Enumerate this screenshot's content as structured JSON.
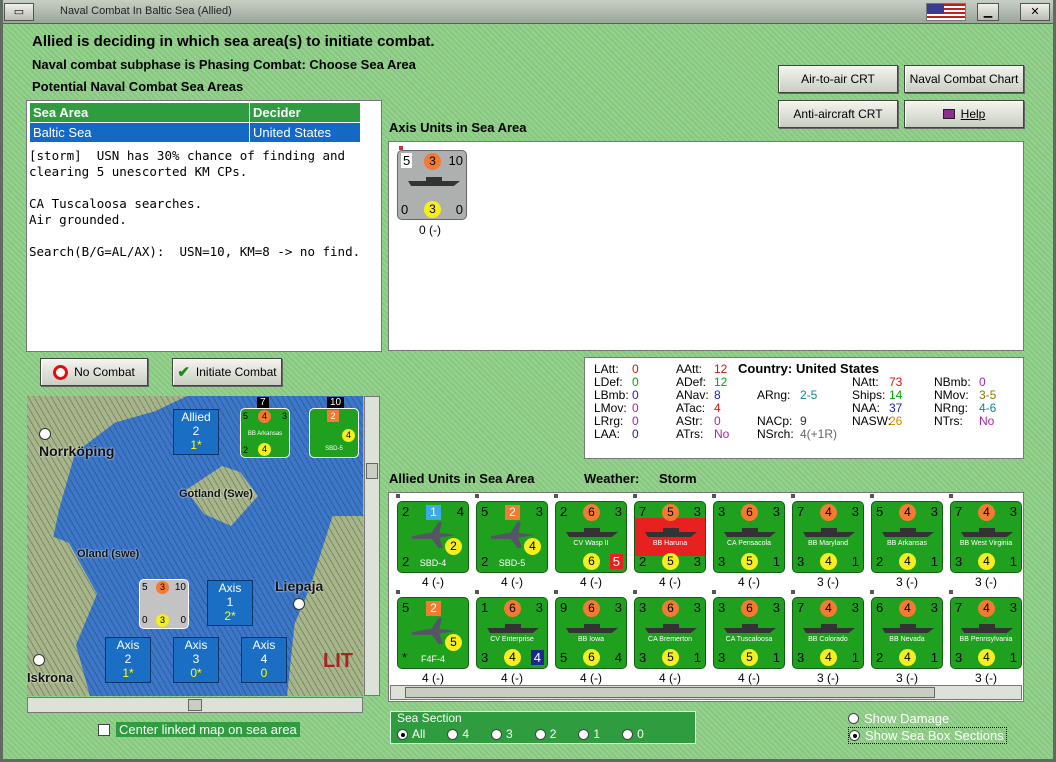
{
  "window": {
    "title": "Naval Combat In Baltic Sea (Allied)"
  },
  "status": {
    "line1": "Allied is deciding in which sea area(s) to initiate combat.",
    "line2": "Naval combat subphase is Phasing Combat: Choose Sea Area",
    "line3": "Potential Naval Combat Sea Areas"
  },
  "buttons": {
    "air_crt": "Air-to-air CRT",
    "naval_chart": "Naval Combat Chart",
    "aa_crt": "Anti-aircraft CRT",
    "help": "Help",
    "no_combat": "No Combat",
    "initiate": "Initiate Combat"
  },
  "areas_table": {
    "headers": [
      "Sea Area",
      "Decider"
    ],
    "rows": [
      [
        "Baltic Sea",
        "United States"
      ]
    ]
  },
  "log": "[storm]  USN has 30% chance of finding and\nclearing 5 unescorted KM CPs.\n\nCA Tuscaloosa searches.\nAir grounded.\n\nSearch(B/G=AL/AX):  USN=10, KM=8 -> no find.",
  "axis": {
    "label": "Axis Units in Sea Area",
    "unit": {
      "tl": "5",
      "tc": "3",
      "tr": "10",
      "bl": "0",
      "bc": "3",
      "br": "0",
      "count": "0 (-)"
    }
  },
  "stats": {
    "latt": "0",
    "ldef": "0",
    "lbmb": "0",
    "lmov": "0",
    "lrg": "0",
    "laa": "0",
    "aatt": "12",
    "adef": "12",
    "anav": "8",
    "atac": "4",
    "astr": "0",
    "atrs": "No",
    "country_label": "Country:",
    "country": "United States",
    "arng": "2-5",
    "nacp": "9",
    "nsrch": "4(+1R)",
    "natt": "73",
    "ships": "14",
    "naa": "37",
    "nasw": "26",
    "nbmb": "0",
    "nmov": "3-5",
    "nrng": "4-6",
    "ntrs": "No",
    "labels": {
      "latt": "LAtt:",
      "ldef": "LDef:",
      "lbmb": "LBmb:",
      "lmov": "LMov:",
      "lrg": "LRrg:",
      "laa": "LAA:",
      "aatt": "AAtt:",
      "adef": "ADef:",
      "anav": "ANav:",
      "atac": "ATac:",
      "astr": "AStr:",
      "atrs": "ATrs:",
      "arng": "ARng:",
      "nacp": "NACp:",
      "nsrch": "NSrch:",
      "natt": "NAtt:",
      "ships": "Ships:",
      "naa": "NAA:",
      "nasw": "NASW:",
      "nbmb": "NBmb:",
      "nmov": "NMov:",
      "nrng": "NRng:",
      "ntrs": "NTrs:"
    }
  },
  "allied": {
    "label": "Allied Units in Sea Area",
    "weather_label": "Weather:",
    "weather": "Storm",
    "row1": [
      {
        "name": "SBD-4",
        "tl": "2",
        "tc": "1",
        "tr": "4",
        "bl": "2",
        "bc": "2",
        "br": "",
        "count": "4 (-)",
        "kind": "plane",
        "tcColor": "#3fa9e8"
      },
      {
        "name": "SBD-5",
        "tl": "5",
        "tc": "2",
        "tr": "3",
        "bl": "2",
        "bc": "4",
        "br": "",
        "count": "4 (-)",
        "kind": "plane",
        "tcColor": "#f47a32"
      },
      {
        "name": "CV Wasp II",
        "tl": "2",
        "tc": "6",
        "tr": "3",
        "bl": "",
        "bc": "6",
        "br": "5",
        "count": "4 (-)",
        "kind": "ship"
      },
      {
        "name": "BB Haruna",
        "tl": "7",
        "tc": "5",
        "tr": "3",
        "bl": "2",
        "bc": "5",
        "br": "3",
        "count": "4 (-)",
        "kind": "ship",
        "red": true
      },
      {
        "name": "CA Pensacola",
        "tl": "3",
        "tc": "6",
        "tr": "3",
        "bl": "3",
        "bc": "5",
        "br": "1",
        "count": "4 (-)",
        "kind": "ship"
      },
      {
        "name": "BB Maryland",
        "tl": "7",
        "tc": "4",
        "tr": "3",
        "bl": "3",
        "bc": "4",
        "br": "1",
        "count": "3 (-)",
        "kind": "ship"
      },
      {
        "name": "BB Arkansas",
        "tl": "5",
        "tc": "4",
        "tr": "3",
        "bl": "2",
        "bc": "4",
        "br": "1",
        "count": "3 (-)",
        "kind": "ship"
      },
      {
        "name": "BB West Virginia",
        "tl": "7",
        "tc": "4",
        "tr": "3",
        "bl": "3",
        "bc": "4",
        "br": "1",
        "count": "3 (-)",
        "kind": "ship"
      }
    ],
    "row2": [
      {
        "name": "F4F-4",
        "tl": "5",
        "tc": "2",
        "tr": "",
        "bl": "*",
        "bc": "5",
        "br": "",
        "count": "4 (-)",
        "kind": "plane",
        "tcColor": "#f47a32"
      },
      {
        "name": "CV Enterprise",
        "tl": "1",
        "tc": "6",
        "tr": "3",
        "bl": "3",
        "bc": "4",
        "br": "4",
        "count": "4 (-)",
        "kind": "ship"
      },
      {
        "name": "BB Iowa",
        "tl": "9",
        "tc": "6",
        "tr": "3",
        "bl": "5",
        "bc": "6",
        "br": "4",
        "count": "4 (-)",
        "kind": "ship"
      },
      {
        "name": "CA Bremerton",
        "tl": "3",
        "tc": "6",
        "tr": "3",
        "bl": "3",
        "bc": "5",
        "br": "1",
        "count": "4 (-)",
        "kind": "ship"
      },
      {
        "name": "CA Tuscaloosa",
        "tl": "3",
        "tc": "6",
        "tr": "3",
        "bl": "3",
        "bc": "5",
        "br": "1",
        "count": "4 (-)",
        "kind": "ship"
      },
      {
        "name": "BB Colorado",
        "tl": "7",
        "tc": "4",
        "tr": "3",
        "bl": "3",
        "bc": "4",
        "br": "1",
        "count": "3 (-)",
        "kind": "ship"
      },
      {
        "name": "BB Nevada",
        "tl": "6",
        "tc": "4",
        "tr": "3",
        "bl": "2",
        "bc": "4",
        "br": "1",
        "count": "3 (-)",
        "kind": "ship"
      },
      {
        "name": "BB Pennsylvania",
        "tl": "7",
        "tc": "4",
        "tr": "3",
        "bl": "3",
        "bc": "4",
        "br": "1",
        "count": "3 (-)",
        "kind": "ship"
      }
    ]
  },
  "map": {
    "labels": {
      "norrkoping": "Norrköping",
      "gotland": "Gotland (Swe)",
      "oland": "Oland (swe)",
      "liepaja": "Liepaja",
      "iskrona": "Iskrona",
      "lit": "LIT"
    },
    "boxes": {
      "allied": {
        "t": "Allied",
        "n": "2",
        "s": "1*"
      },
      "axis1": {
        "t": "Axis",
        "n": "1",
        "s": "2*"
      },
      "axis2": {
        "t": "Axis",
        "n": "2",
        "s": "1*"
      },
      "axis3": {
        "t": "Axis",
        "n": "3",
        "s": "0*"
      },
      "axis4": {
        "t": "Axis",
        "n": "4",
        "s": "0"
      }
    },
    "stack7": "7",
    "stack10": "10",
    "mini1": {
      "tl": "5",
      "tc": "4",
      "tr": "3",
      "bl": "2",
      "bc": "4",
      "nm": "BB Arkansas"
    },
    "mini2": {
      "tc": "2",
      "bc": "4",
      "nm": "SBD-5"
    },
    "miniAxis": {
      "tl": "5",
      "tc": "3",
      "tr": "10",
      "bl": "0",
      "bc": "3",
      "br": "0"
    }
  },
  "options": {
    "center_map": "Center linked map on sea area",
    "sea_section": "Sea Section",
    "sections": [
      "All",
      "4",
      "3",
      "2",
      "1",
      "0"
    ],
    "show_damage": "Show Damage",
    "show_boxes": "Show Sea Box Sections"
  },
  "colors": {
    "orange": "#f47a32",
    "yellow": "#f5ee20",
    "unit_green": "#1fa01f",
    "haruna_red": "#e82020"
  }
}
